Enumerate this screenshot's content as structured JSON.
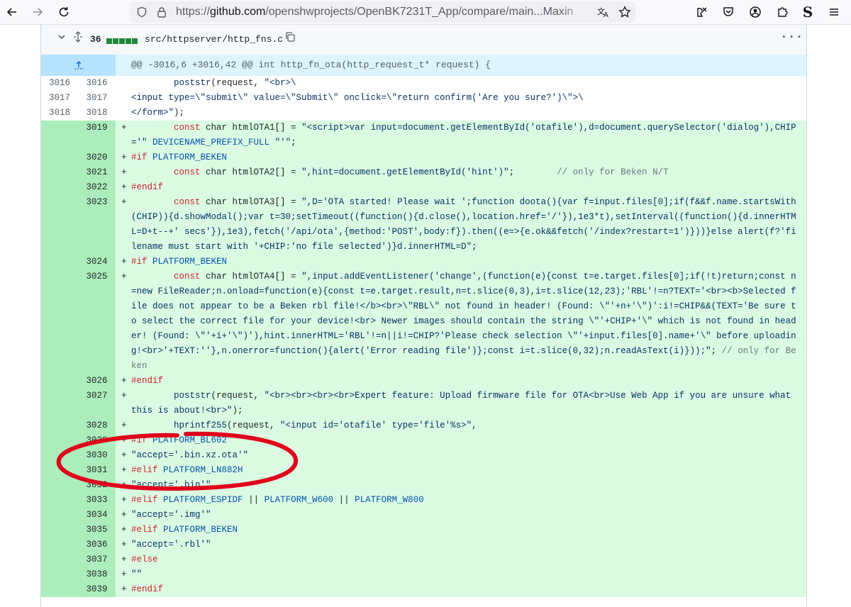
{
  "browser": {
    "url_prefix": "https://",
    "url_host": "github.com",
    "url_path": "/openshwprojects/OpenBK7231T_App/compare/main...Maxin",
    "icons": [
      "back-arrow-icon",
      "forward-arrow-icon",
      "reload-icon",
      "shield-icon",
      "lock-icon",
      "translate-icon",
      "star-icon",
      "extension-icon",
      "pocket-icon",
      "account-icon",
      "puzzle-icon",
      "s-extension-icon",
      "menu-icon"
    ]
  },
  "file": {
    "changes": "36",
    "path": "src/httpserver/http_fns.c",
    "more": "···"
  },
  "hunk": {
    "header": "@@ -3016,6 +3016,42 @@ int http_fn_ota(http_request_t* request) {"
  },
  "lines": [
    {
      "type": "ctx",
      "old": "3016",
      "new": "3016",
      "html": "        <span class='str'>poststr</span>(request, <span class='str'>\"&lt;br&gt;\\</span>"
    },
    {
      "type": "ctx",
      "old": "3017",
      "new": "3017",
      "html": "<span class='str'>&lt;input type=\\\"submit\\\" value=\\\"Submit\\\" onclick=\\\"return confirm('Are you sure?')\\\"&gt;\\</span>"
    },
    {
      "type": "ctx",
      "old": "3018",
      "new": "3018",
      "html": "<span class='str'>&lt;/form&gt;\"</span>);"
    },
    {
      "type": "add",
      "old": "",
      "new": "3019",
      "html": "        <span class='kw'>const</span> char htmlOTA1[] = <span class='str'>\"&lt;script&gt;var input=document.getElementById('otafile'),d=document.querySelector('dialog'),CHIP='\"</span> <span class='mac'>DEVICENAME_PREFIX_FULL</span> <span class='str'>\"'\"</span>;"
    },
    {
      "type": "add",
      "old": "",
      "new": "3020",
      "html": "<span class='kw'>#if</span> <span class='mac'>PLATFORM_BEKEN</span>"
    },
    {
      "type": "add",
      "old": "",
      "new": "3021",
      "html": "        <span class='kw'>const</span> char htmlOTA2[] = <span class='str'>\",hint=document.getElementById('hint')\"</span>;        <span class='cmt'>// only for Beken N/T</span>"
    },
    {
      "type": "add",
      "old": "",
      "new": "3022",
      "html": "<span class='kw'>#endif</span>"
    },
    {
      "type": "add",
      "old": "",
      "new": "3023",
      "html": "        <span class='kw'>const</span> char htmlOTA3[] = <span class='str'>\",D='OTA started! Please wait ';function doota(){var f=input.files[0];if(f&amp;&amp;f.name.startsWith(CHIP)){d.showModal();var t=30;setTimeout((function(){d.close(),location.href='/'}),1e3*t),setInterval((function(){d.innerHTML=D+t--+' secs'}),1e3),fetch('/api/ota',{method:'POST',body:f}).then((e=&gt;{e.ok&amp;&amp;fetch('/index?restart=1')}))}else alert(f?'filename must start with '+CHIP:'no file selected')}d.innerHTML=D\"</span>;"
    },
    {
      "type": "add",
      "old": "",
      "new": "3024",
      "html": "<span class='kw'>#if</span> <span class='mac'>PLATFORM_BEKEN</span>"
    },
    {
      "type": "add",
      "old": "",
      "new": "3025",
      "html": "        <span class='kw'>const</span> char htmlOTA4[] = <span class='str'>\",input.addEventListener('change',(function(e){const t=e.target.files[0];if(!t)return;const n=new FileReader;n.onload=function(e){const t=e.target.result,n=t.slice(0,3),i=t.slice(12,23);'RBL'!=n?TEXT='&lt;br&gt;&lt;b&gt;Selected file does not appear to be a Beken rbl file!&lt;/b&gt;&lt;br&gt;\\\"RBL\\\" not found in header! (Found: \\\"'+n+'\\\")':i!=CHIP&amp;&amp;(TEXT='Be sure to select the correct file for your device!&lt;br&gt; Newer images should contain the string \\\"'+CHIP+'\\\" which is not found in header! (Found: \\\"'+i+'\\\")'),hint.innerHTML='RBL'!=n||i!=CHIP?'Please check selection \\\"'+input.files[0].name+'\\\" before uploading!&lt;br&gt;'+TEXT:''},n.onerror=function(){alert('Error reading file')};const i=t.slice(0,32);n.readAsText(i)}));\"</span>; <span class='cmt'>// only for Beken</span>"
    },
    {
      "type": "add",
      "old": "",
      "new": "3026",
      "html": "<span class='kw'>#endif</span>"
    },
    {
      "type": "add",
      "old": "",
      "new": "3027",
      "html": "        <span class='str'>poststr</span>(request, <span class='str'>\"&lt;br&gt;&lt;br&gt;&lt;br&gt;&lt;br&gt;Expert feature: Upload firmware file for OTA&lt;br&gt;Use Web App if you are unsure what this is about!&lt;br&gt;\"</span>);"
    },
    {
      "type": "add",
      "old": "",
      "new": "3028",
      "html": "        <span class='str'>hprintf255</span>(request, <span class='str'>\"&lt;input id='otafile' type='file'%s&gt;\"</span>,"
    },
    {
      "type": "add",
      "old": "",
      "new": "3029",
      "html": "<span class='kw'>#if</span> <span class='mac'>PLATFORM_BL602</span>"
    },
    {
      "type": "add",
      "old": "",
      "new": "3030",
      "html": "<span class='str'>\"accept='.bin.xz.ota'\"</span>"
    },
    {
      "type": "add",
      "old": "",
      "new": "3031",
      "html": "<span class='kw'>#elif</span> <span class='mac'>PLATFORM_LN882H</span>"
    },
    {
      "type": "add",
      "old": "",
      "new": "3032",
      "html": "<span class='str'>\"accept='.bin'\"</span>"
    },
    {
      "type": "add",
      "old": "",
      "new": "3033",
      "html": "<span class='kw'>#elif</span> <span class='mac'>PLATFORM_ESPIDF</span> || <span class='mac'>PLATFORM_W600</span> || <span class='mac'>PLATFORM_W800</span>"
    },
    {
      "type": "add",
      "old": "",
      "new": "3034",
      "html": "<span class='str'>\"accept='.img'\"</span>"
    },
    {
      "type": "add",
      "old": "",
      "new": "3035",
      "html": "<span class='kw'>#elif</span> <span class='mac'>PLATFORM_BEKEN</span>"
    },
    {
      "type": "add",
      "old": "",
      "new": "3036",
      "html": "<span class='str'>\"accept='.rbl'\"</span>"
    },
    {
      "type": "add",
      "old": "",
      "new": "3037",
      "html": "<span class='kw'>#else</span>"
    },
    {
      "type": "add",
      "old": "",
      "new": "3038",
      "html": "<span class='str'>\"\"</span>"
    },
    {
      "type": "add",
      "old": "",
      "new": "3039",
      "html": "<span class='kw'>#endif</span>"
    }
  ],
  "colors": {
    "add_bg": "#dafbe1",
    "add_gutter": "#aceebb",
    "hunk_bg": "#ddf4ff",
    "annotation": "#e0001b"
  }
}
